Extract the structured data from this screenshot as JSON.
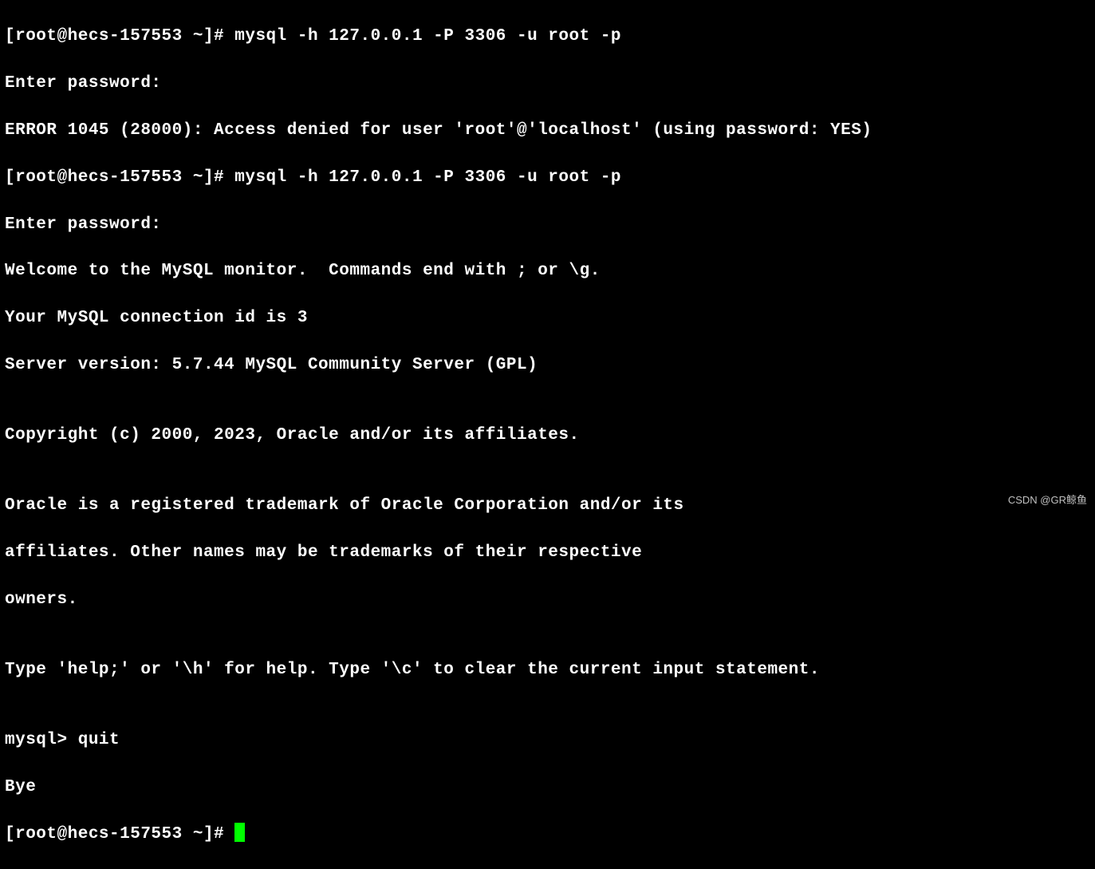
{
  "terminal": {
    "lines": [
      "[root@hecs-157553 ~]# mysql -h 127.0.0.1 -P 3306 -u root -p",
      "Enter password:",
      "ERROR 1045 (28000): Access denied for user 'root'@'localhost' (using password: YES)",
      "[root@hecs-157553 ~]# mysql -h 127.0.0.1 -P 3306 -u root -p",
      "Enter password:",
      "Welcome to the MySQL monitor.  Commands end with ; or \\g.",
      "Your MySQL connection id is 3",
      "Server version: 5.7.44 MySQL Community Server (GPL)",
      "",
      "Copyright (c) 2000, 2023, Oracle and/or its affiliates.",
      "",
      "Oracle is a registered trademark of Oracle Corporation and/or its",
      "affiliates. Other names may be trademarks of their respective",
      "owners.",
      "",
      "Type 'help;' or '\\h' for help. Type '\\c' to clear the current input statement.",
      "",
      "mysql> quit",
      "Bye"
    ],
    "final_prompt": "[root@hecs-157553 ~]# "
  },
  "watermark": "CSDN @GR鲸鱼"
}
